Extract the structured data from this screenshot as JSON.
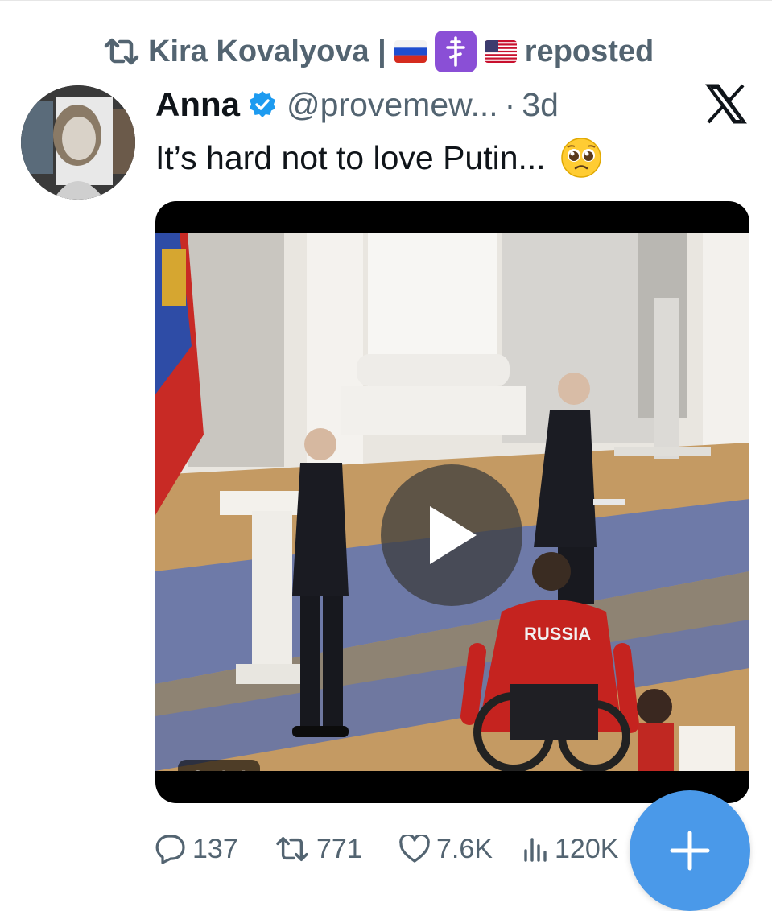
{
  "repost_header": {
    "user": "Kira Kovalyova |",
    "label": "reposted",
    "icon": "repost-icon"
  },
  "author": {
    "name": "Anna",
    "handle": "@provemew...",
    "separator": "·",
    "time": "3d",
    "verified_color": "#1d9bf0"
  },
  "tweet": {
    "text": "It’s hard not to love Putin...",
    "emoji": "🥹"
  },
  "video": {
    "duration": "0:14",
    "jersey_text": "RUSSIA"
  },
  "actions": {
    "replies": "137",
    "reposts": "771",
    "likes": "7.6K",
    "views": "120K"
  },
  "colors": {
    "muted": "#536471",
    "fab": "#4a99e9"
  }
}
